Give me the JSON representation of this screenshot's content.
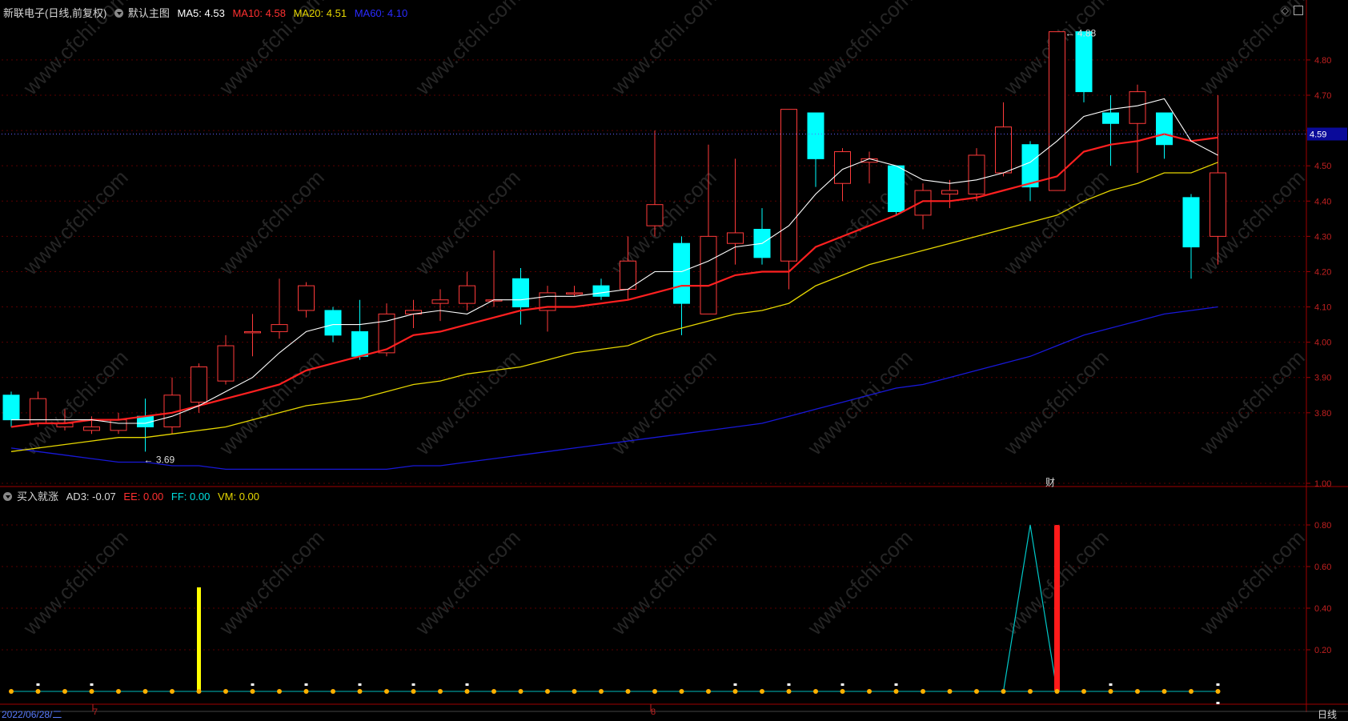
{
  "main_header": {
    "stock": "新联电子(日线,前复权)",
    "template": "默认主图",
    "ma5": "MA5: 4.53",
    "ma10": "MA10: 4.58",
    "ma20": "MA20: 4.51",
    "ma60": "MA60: 4.10"
  },
  "sub_header": {
    "indicator": "买入就涨",
    "ad3": "AD3: -0.07",
    "ee": "EE: 0.00",
    "ff": "FF: 0.00",
    "vm": "VM: 0.00"
  },
  "footer": {
    "date": "2022/06/28/二",
    "month_marks": [
      "7",
      "8"
    ],
    "period_tab": "日线"
  },
  "marks": {
    "high_label": "4.88",
    "low_label": "3.69",
    "fin_marker": "财",
    "current_price": "4.59"
  },
  "watermark": "www.cfchi.com",
  "colors": {
    "up": "#ff3a3a",
    "down": "#00ffff",
    "ma5": "#ffffff",
    "ma10": "#ff2020",
    "ma20": "#e6d700",
    "ma60": "#1818d8",
    "axis": "#a00000"
  },
  "chart_data": [
    {
      "type": "candlestick",
      "ylim": [
        3.6,
        4.92
      ],
      "y_ticks": [
        "3.80",
        "3.90",
        "4.00",
        "4.10",
        "4.20",
        "4.30",
        "4.40",
        "4.50",
        "4.60",
        "4.70",
        "4.80"
      ],
      "candles": [
        [
          3.85,
          3.78,
          3.86,
          3.76
        ],
        [
          3.77,
          3.84,
          3.86,
          3.76
        ],
        [
          3.76,
          3.77,
          3.81,
          3.75
        ],
        [
          3.75,
          3.76,
          3.79,
          3.74
        ],
        [
          3.75,
          3.78,
          3.8,
          3.74
        ],
        [
          3.79,
          3.76,
          3.84,
          3.69
        ],
        [
          3.76,
          3.85,
          3.9,
          3.74
        ],
        [
          3.83,
          3.93,
          3.94,
          3.8
        ],
        [
          3.89,
          3.99,
          4.02,
          3.88
        ],
        [
          4.03,
          4.03,
          4.08,
          3.96
        ],
        [
          4.03,
          4.05,
          4.18,
          4.01
        ],
        [
          4.09,
          4.16,
          4.17,
          4.07
        ],
        [
          4.09,
          4.02,
          4.1,
          4.0
        ],
        [
          4.03,
          3.96,
          4.12,
          3.95
        ],
        [
          3.97,
          4.08,
          4.11,
          3.96
        ],
        [
          4.08,
          4.09,
          4.12,
          4.04
        ],
        [
          4.11,
          4.12,
          4.15,
          4.06
        ],
        [
          4.11,
          4.16,
          4.2,
          4.09
        ],
        [
          4.12,
          4.12,
          4.26,
          4.1
        ],
        [
          4.18,
          4.1,
          4.21,
          4.05
        ],
        [
          4.09,
          4.14,
          4.16,
          4.03
        ],
        [
          4.14,
          4.14,
          4.16,
          4.13
        ],
        [
          4.16,
          4.13,
          4.18,
          4.12
        ],
        [
          4.15,
          4.23,
          4.3,
          4.12
        ],
        [
          4.33,
          4.39,
          4.6,
          4.3
        ],
        [
          4.28,
          4.11,
          4.3,
          4.02
        ],
        [
          4.08,
          4.3,
          4.56,
          4.08
        ],
        [
          4.28,
          4.31,
          4.52,
          4.22
        ],
        [
          4.32,
          4.24,
          4.38,
          4.22
        ],
        [
          4.23,
          4.66,
          4.66,
          4.15
        ],
        [
          4.65,
          4.52,
          4.65,
          4.44
        ],
        [
          4.45,
          4.54,
          4.55,
          4.4
        ],
        [
          4.51,
          4.52,
          4.54,
          4.45
        ],
        [
          4.5,
          4.37,
          4.5,
          4.36
        ],
        [
          4.36,
          4.43,
          4.45,
          4.32
        ],
        [
          4.42,
          4.43,
          4.46,
          4.38
        ],
        [
          4.42,
          4.53,
          4.55,
          4.4
        ],
        [
          4.48,
          4.61,
          4.68,
          4.47
        ],
        [
          4.56,
          4.44,
          4.57,
          4.4
        ],
        [
          4.43,
          4.88,
          4.88,
          4.43
        ],
        [
          4.88,
          4.71,
          4.88,
          4.68
        ],
        [
          4.65,
          4.62,
          4.7,
          4.5
        ],
        [
          4.62,
          4.71,
          4.73,
          4.48
        ],
        [
          4.65,
          4.56,
          4.65,
          4.52
        ],
        [
          4.41,
          4.27,
          4.42,
          4.18
        ],
        [
          4.3,
          4.48,
          4.7,
          4.22
        ]
      ],
      "ma5": [
        3.78,
        3.78,
        3.78,
        3.78,
        3.77,
        3.77,
        3.79,
        3.82,
        3.86,
        3.9,
        3.97,
        4.03,
        4.05,
        4.05,
        4.06,
        4.08,
        4.09,
        4.08,
        4.12,
        4.12,
        4.13,
        4.13,
        4.14,
        4.15,
        4.2,
        4.2,
        4.23,
        4.27,
        4.28,
        4.33,
        4.42,
        4.49,
        4.52,
        4.5,
        4.46,
        4.45,
        4.46,
        4.48,
        4.51,
        4.57,
        4.64,
        4.66,
        4.67,
        4.69,
        4.57,
        4.53
      ],
      "ma10": [
        3.76,
        3.77,
        3.77,
        3.78,
        3.78,
        3.79,
        3.8,
        3.82,
        3.84,
        3.86,
        3.88,
        3.92,
        3.94,
        3.96,
        3.98,
        4.02,
        4.03,
        4.05,
        4.07,
        4.09,
        4.1,
        4.1,
        4.11,
        4.12,
        4.14,
        4.16,
        4.16,
        4.19,
        4.2,
        4.2,
        4.27,
        4.3,
        4.33,
        4.36,
        4.4,
        4.4,
        4.41,
        4.43,
        4.45,
        4.47,
        4.54,
        4.56,
        4.57,
        4.59,
        4.57,
        4.58
      ],
      "ma20": [
        3.69,
        3.7,
        3.71,
        3.72,
        3.73,
        3.73,
        3.74,
        3.75,
        3.76,
        3.78,
        3.8,
        3.82,
        3.83,
        3.84,
        3.86,
        3.88,
        3.89,
        3.91,
        3.92,
        3.93,
        3.95,
        3.97,
        3.98,
        3.99,
        4.02,
        4.04,
        4.06,
        4.08,
        4.09,
        4.11,
        4.16,
        4.19,
        4.22,
        4.24,
        4.26,
        4.28,
        4.3,
        4.32,
        4.34,
        4.36,
        4.4,
        4.43,
        4.45,
        4.48,
        4.48,
        4.51
      ],
      "ma60": [
        3.7,
        3.69,
        3.68,
        3.67,
        3.66,
        3.66,
        3.65,
        3.65,
        3.64,
        3.64,
        3.64,
        3.64,
        3.64,
        3.64,
        3.64,
        3.65,
        3.65,
        3.66,
        3.67,
        3.68,
        3.69,
        3.7,
        3.71,
        3.72,
        3.73,
        3.74,
        3.75,
        3.76,
        3.77,
        3.79,
        3.81,
        3.83,
        3.85,
        3.87,
        3.88,
        3.9,
        3.92,
        3.94,
        3.96,
        3.99,
        4.02,
        4.04,
        4.06,
        4.08,
        4.09,
        4.1
      ]
    },
    {
      "type": "bar",
      "name": "买入就涨",
      "ylim": [
        0,
        1.0
      ],
      "y_ticks": [
        "0.20",
        "0.40",
        "0.60",
        "0.80",
        "1.00"
      ],
      "yellow_bar": {
        "index": 7,
        "value": 0.5
      },
      "red_bar": {
        "index": 39,
        "value": 0.8
      },
      "ff_peak": {
        "index": 38,
        "value": 0.8
      },
      "white_tick_indices": [
        1,
        3,
        9,
        11,
        13,
        15,
        17,
        27,
        29,
        31,
        33,
        41,
        45
      ]
    }
  ]
}
